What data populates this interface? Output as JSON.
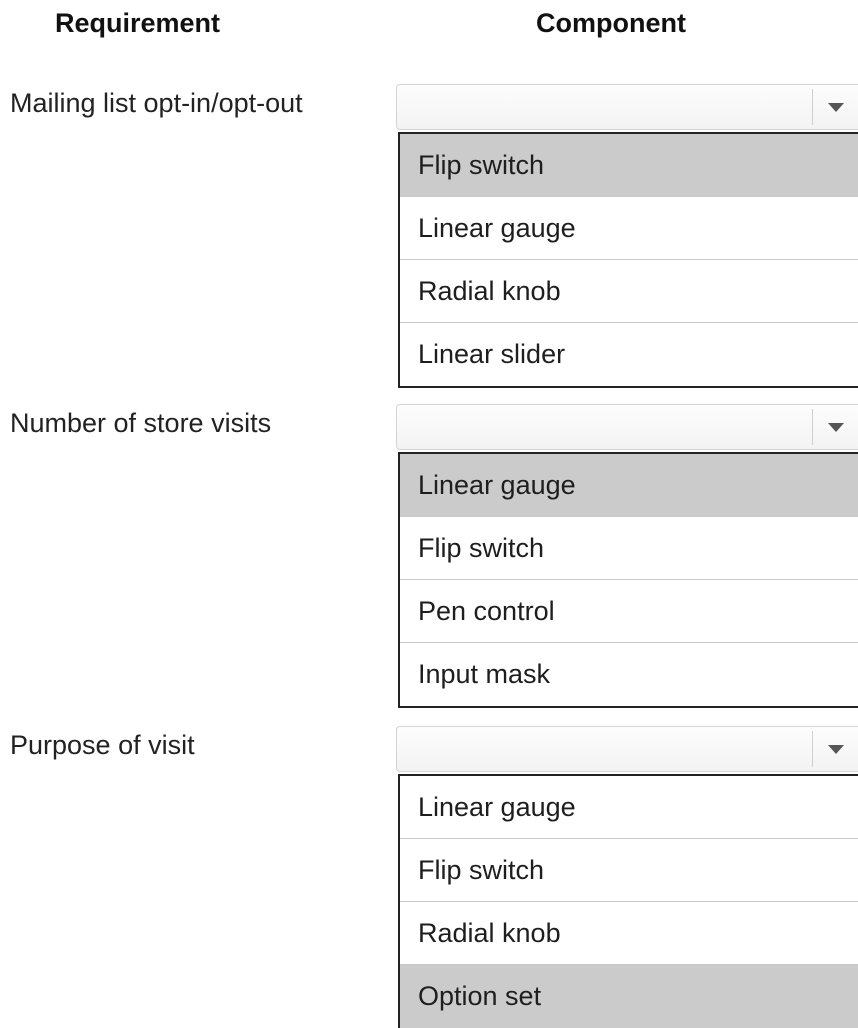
{
  "headers": {
    "requirement": "Requirement",
    "component": "Component"
  },
  "groups": [
    {
      "requirement": "Mailing list opt-in/opt-out",
      "selected": "",
      "options": [
        {
          "label": "Flip switch",
          "highlighted": true
        },
        {
          "label": "Linear gauge",
          "highlighted": false
        },
        {
          "label": "Radial knob",
          "highlighted": false
        },
        {
          "label": "Linear slider",
          "highlighted": false
        }
      ]
    },
    {
      "requirement": "Number of store visits",
      "selected": "",
      "options": [
        {
          "label": "Linear gauge",
          "highlighted": true
        },
        {
          "label": "Flip switch",
          "highlighted": false
        },
        {
          "label": "Pen control",
          "highlighted": false
        },
        {
          "label": "Input mask",
          "highlighted": false
        }
      ]
    },
    {
      "requirement": "Purpose of visit",
      "selected": "",
      "options": [
        {
          "label": "Linear gauge",
          "highlighted": false
        },
        {
          "label": "Flip switch",
          "highlighted": false
        },
        {
          "label": "Radial knob",
          "highlighted": false
        },
        {
          "label": "Option set",
          "highlighted": true
        }
      ]
    }
  ],
  "colors": {
    "highlight": "#cbcbcb",
    "border": "#222222"
  }
}
